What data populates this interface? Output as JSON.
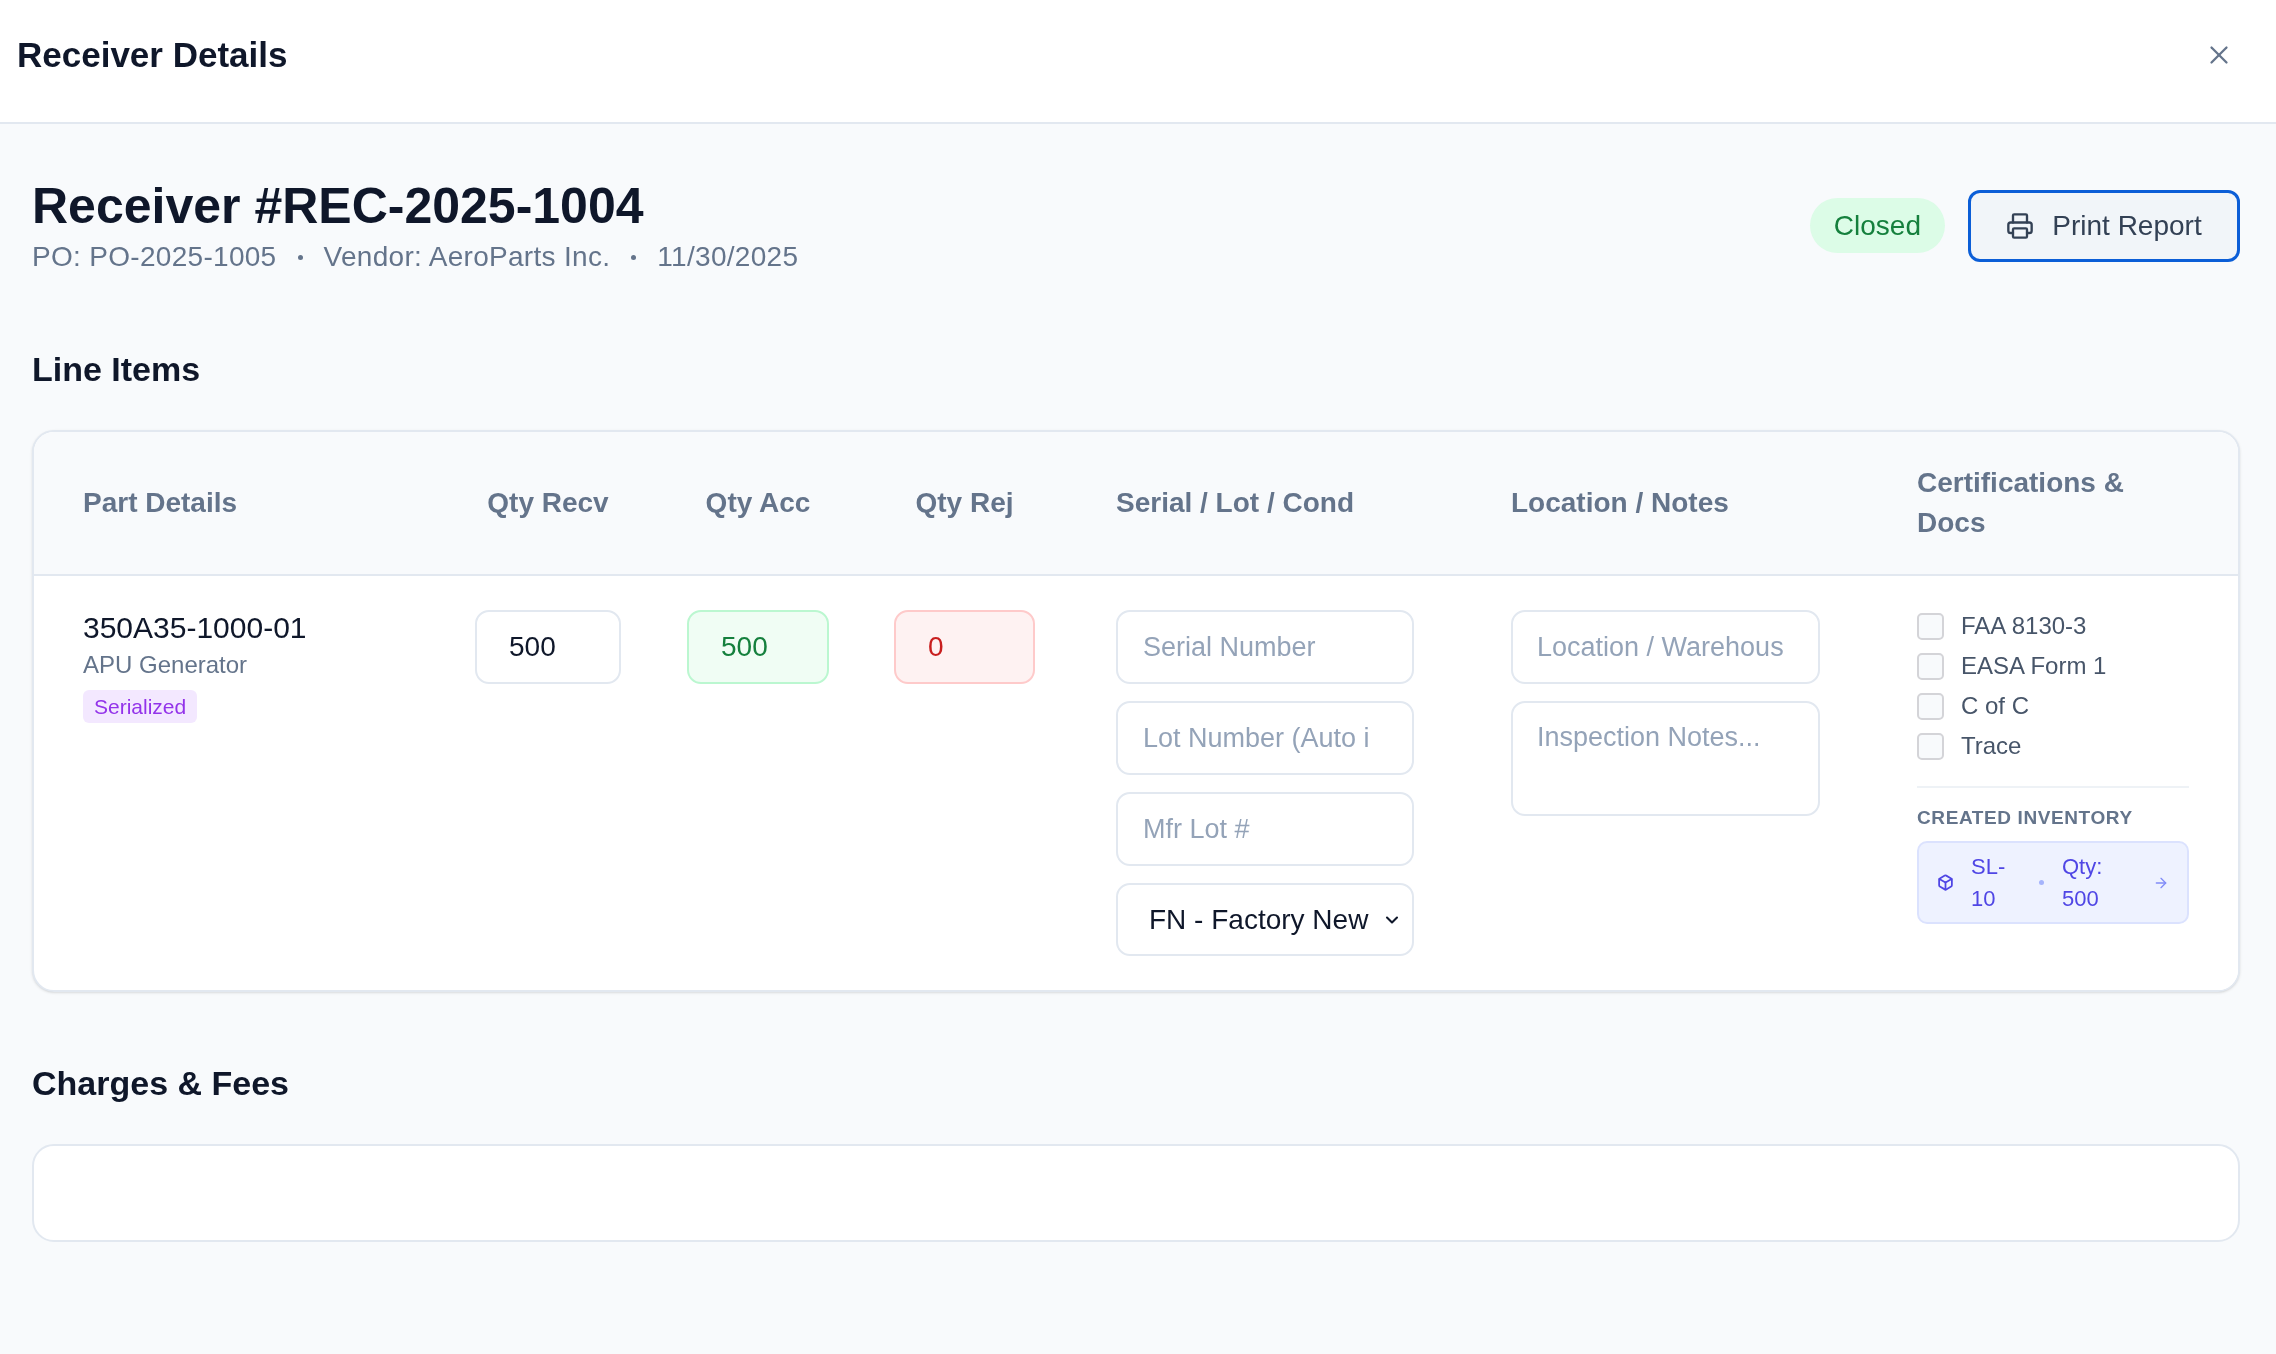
{
  "dialog": {
    "title": "Receiver Details"
  },
  "receiver": {
    "title": "Receiver #REC-2025-1004",
    "meta": [
      "PO: PO-2025-1005",
      "Vendor: AeroParts Inc.",
      "11/30/2025"
    ],
    "status": "Closed",
    "print_button": {
      "label": "Print Report",
      "focused": true
    }
  },
  "line_items": {
    "heading": "Line Items",
    "columns": [
      "Part Details",
      "Qty Recv",
      "Qty Acc",
      "Qty Rej",
      "Serial / Lot / Cond",
      "Location / Notes",
      "Certifications & Docs"
    ],
    "rows": [
      {
        "part_number": "350A35-1000-01",
        "description": "APU Generator",
        "tag": "Serialized",
        "quantities": [
          {
            "kind": "received",
            "value": "500"
          },
          {
            "kind": "accepted",
            "value": "500"
          },
          {
            "kind": "rejected",
            "value": "0"
          }
        ],
        "serial_fields": [
          {
            "placeholder": "Serial Number"
          },
          {
            "placeholder": "Lot Number (Auto i"
          },
          {
            "placeholder": "Mfr Lot #"
          }
        ],
        "condition": "FN - Factory New",
        "location": {
          "placeholder": "Location / Warehous"
        },
        "notes": {
          "placeholder": "Inspection Notes..."
        },
        "certifications": [
          {
            "label": "FAA 8130-3",
            "checked": false
          },
          {
            "label": "EASA Form 1",
            "checked": false
          },
          {
            "label": "C of C",
            "checked": false
          },
          {
            "label": "Trace",
            "checked": false
          }
        ],
        "created_inventory": {
          "label": "CREATED INVENTORY",
          "items": [
            {
              "id": "SL-10",
              "qty": "Qty: 500"
            }
          ]
        }
      }
    ]
  },
  "charges": {
    "heading": "Charges & Fees"
  }
}
